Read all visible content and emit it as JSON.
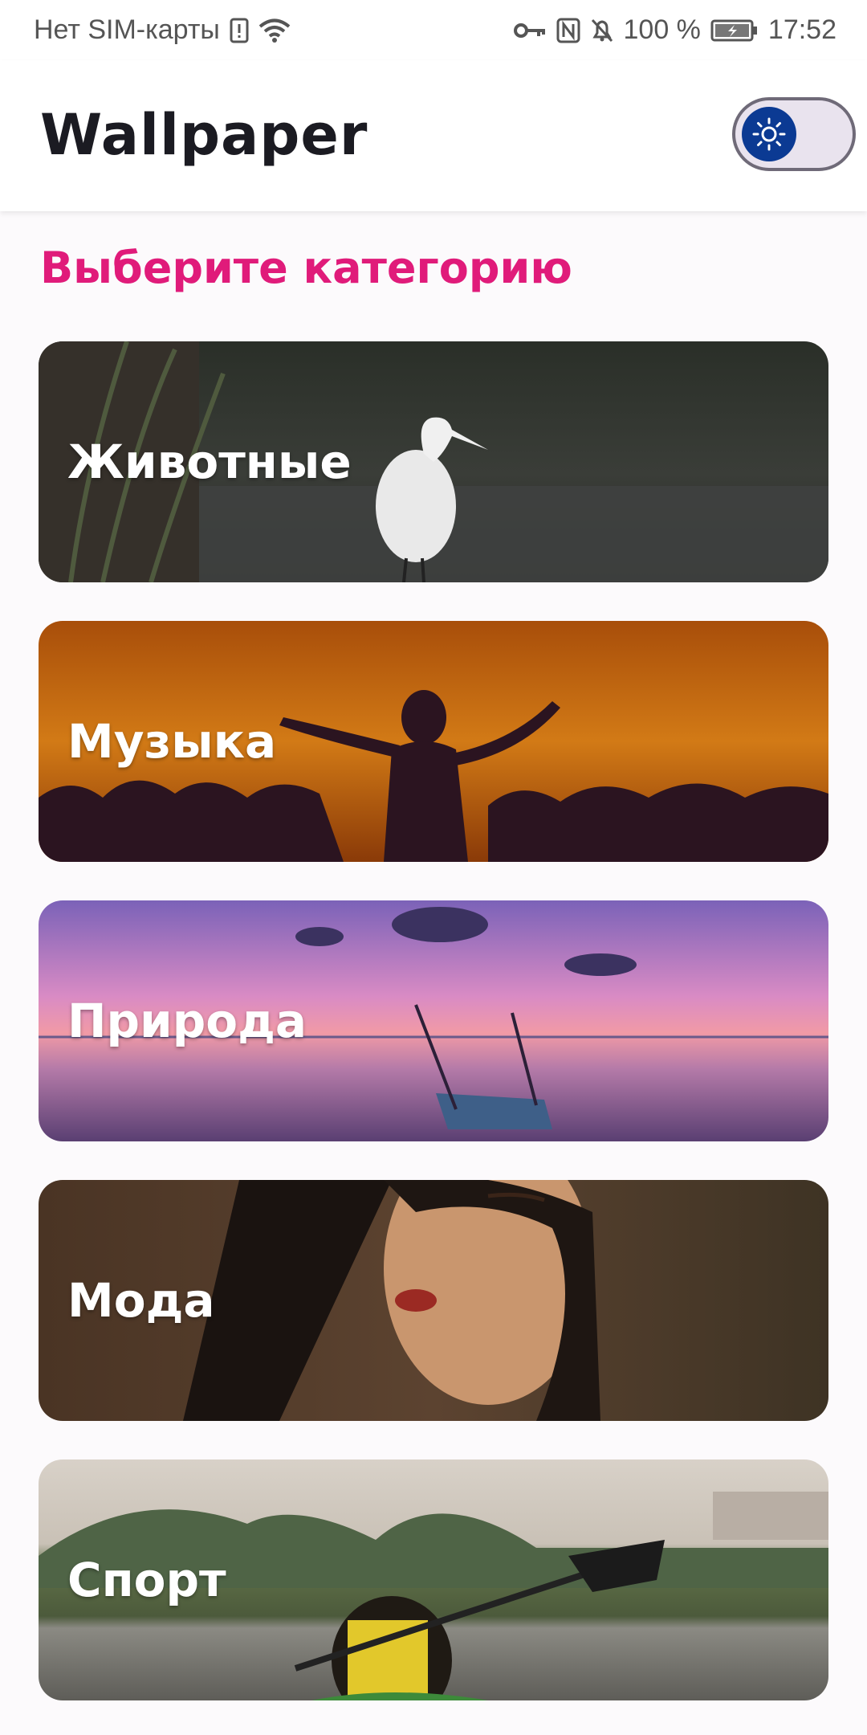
{
  "status_bar": {
    "carrier": "Нет SIM-карты",
    "battery": "100 %",
    "time": "17:52"
  },
  "app_bar": {
    "title": "Wallpaper",
    "theme_toggle_icon": "sun-icon"
  },
  "section_title": "Выберите категорию",
  "categories": [
    {
      "label": "Животные"
    },
    {
      "label": "Музыка"
    },
    {
      "label": "Природа"
    },
    {
      "label": "Мода"
    },
    {
      "label": "Спорт"
    }
  ],
  "colors": {
    "accent": "#e01b7a",
    "toggle_thumb": "#0b3a93",
    "title": "#1b1b22"
  }
}
